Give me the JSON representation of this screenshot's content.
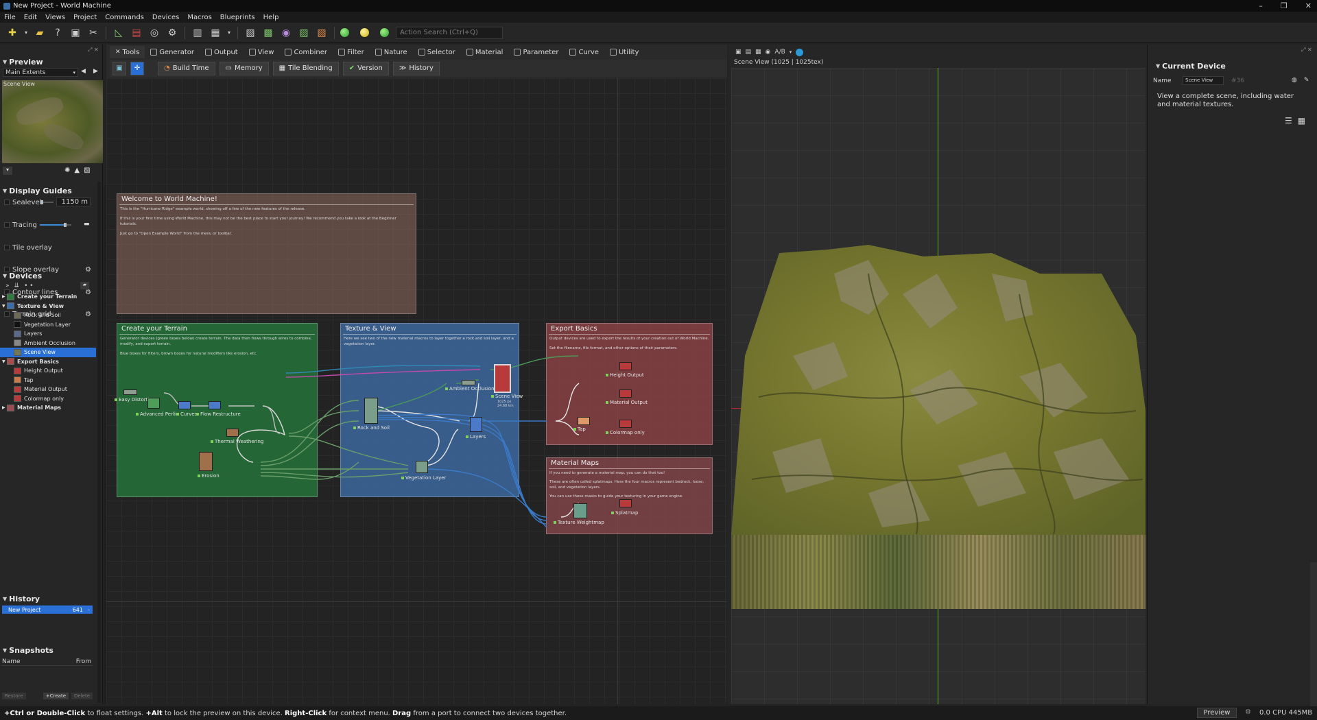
{
  "window": {
    "title": "New Project - World Machine",
    "controls": [
      "–",
      "❐",
      "✕"
    ]
  },
  "menu": [
    "File",
    "Edit",
    "Views",
    "Project",
    "Commands",
    "Devices",
    "Macros",
    "Blueprints",
    "Help"
  ],
  "toolbar": {
    "search_placeholder": "Action Search (Ctrl+Q)"
  },
  "preview": {
    "title": "Preview",
    "extents": "Main Extents",
    "thumb_label": "Scene View"
  },
  "guides": {
    "title": "Display Guides",
    "sealevel_label": "Sealevel",
    "sealevel_value": "1150 m",
    "sealevel_fraction": 0.15,
    "tracing_label": "Tracing",
    "tracing_fraction": 0.8,
    "items": [
      "Tile overlay",
      "Slope overlay",
      "Contour lines",
      "Terrain grid"
    ]
  },
  "devices": {
    "title": "Devices",
    "groups": [
      {
        "label": "Create your Terrain",
        "color": "#2f7a3f",
        "children": []
      },
      {
        "label": "Texture & View",
        "color": "#3b6ea8",
        "children": [
          "Rock and Soil",
          "Vegetation Layer",
          "Layers",
          "Ambient Occlusion",
          "Scene View"
        ]
      },
      {
        "label": "Export Basics",
        "color": "#a84b4b",
        "children": [
          "Height Output",
          "Tap",
          "Material Output",
          "Colormap only"
        ]
      },
      {
        "label": "Material Maps",
        "color": "#9a4c52",
        "children": []
      }
    ]
  },
  "history": {
    "title": "History",
    "item": "New Project",
    "count": "641"
  },
  "snapshots": {
    "title": "Snapshots",
    "col_name": "Name",
    "col_from": "From",
    "buttons": [
      "Restore",
      "+Create",
      "Delete"
    ]
  },
  "tabs": [
    "Tools",
    "Generator",
    "Output",
    "View",
    "Combiner",
    "Filter",
    "Nature",
    "Selector",
    "Material",
    "Parameter",
    "Curve",
    "Utility"
  ],
  "subtools": [
    "Build Time",
    "Memory",
    "Tile Blending",
    "Version",
    "History"
  ],
  "graph": {
    "welcome": {
      "title": "Welcome to World Machine!",
      "lines": [
        "This is the \"Hurricane Ridge\" example world, showing off a few of the new features of the release.",
        "If this is your first time using World Machine, this may not be the best place to start your journey! We recommend you take a look at the Beginner tutorials.",
        "Just go to \"Open Example World\" from the menu or toolbar."
      ]
    },
    "create": {
      "title": "Create your Terrain",
      "lines": [
        "Generator devices (green boxes below) create terrain. The data then flows through wires to combine, modify, and export terrain.",
        "Blue boxes for filters, brown boxes for natural modifiers like erosion, etc."
      ],
      "nodes": [
        "Easy Distortion",
        "Advanced Perlin",
        "Curves",
        "Flow Restructure",
        "Thermal Weathering",
        "Erosion"
      ]
    },
    "texture": {
      "title": "Texture & View",
      "lines": [
        "Here we see two of the new material macros to layer together a rock and soil layer, and a vegetation layer."
      ],
      "nodes": [
        "Ambient Occlusion",
        "Scene View",
        "Rock and Soil",
        "Layers",
        "Vegetation Layer"
      ],
      "scene_sub": "1025 px\n24.68 km"
    },
    "export": {
      "title": "Export Basics",
      "lines": [
        "Output devices are used to export the results of your creation out of World Machine.",
        "Set the filename, file format, and other options of their parameters."
      ],
      "nodes": [
        "Height Output",
        "Material Output",
        "Tap",
        "Colormap only"
      ]
    },
    "material": {
      "title": "Material Maps",
      "lines": [
        "If you need to generate a material map, you can do that too!",
        "These are often called splatmaps. Here the four macros represent bedrock, loose, soil, and vegetation layers.",
        "You can use these masks to guide your texturing in your game engine."
      ],
      "nodes": [
        "Texture Weightmap",
        "Splatmap"
      ]
    }
  },
  "viewport": {
    "label": "Scene View (1025 | 1025tex)",
    "ab": "A/B"
  },
  "current_device": {
    "title": "Current Device",
    "name_label": "Name",
    "name_value": "Scene View",
    "id": "#36",
    "description": "View a complete scene, including water and material textures."
  },
  "status": {
    "hint_parts": [
      "+Ctrl or Double-Click",
      " to float settings. ",
      "+Alt",
      " to lock the preview on this device. ",
      "Right-Click",
      " for context menu. ",
      "Drag",
      " from a port to connect two devices together."
    ],
    "preview_btn": "Preview",
    "cpu": "0.0 CPU 445MB"
  }
}
